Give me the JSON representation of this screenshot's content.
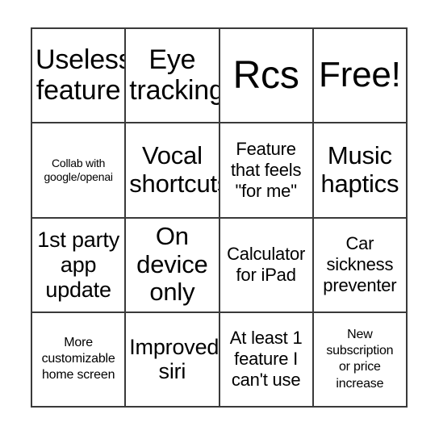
{
  "card": {
    "type": "bingo-card",
    "columns": 4,
    "rows": 4,
    "background_color": "#ffffff",
    "grid_line_color": "#3a3a3a",
    "text_color": "#000000",
    "cells": [
      {
        "text": "Useless\nfeature",
        "size": "fs-xxl"
      },
      {
        "text": "Eye\ntracking",
        "size": "fs-xxl"
      },
      {
        "text": "Rcs",
        "size": "fs-h0"
      },
      {
        "text": "Free!",
        "size": "fs-h1"
      },
      {
        "text": "Collab with\ngoogle/openai",
        "size": "fs-xs"
      },
      {
        "text": "Vocal\nshortcuts",
        "size": "fs-xl"
      },
      {
        "text": "Feature\nthat feels\n\"for me\"",
        "size": "fs-m"
      },
      {
        "text": "Music\nhaptics",
        "size": "fs-xl"
      },
      {
        "text": "1st party\napp\nupdate",
        "size": "fs-l"
      },
      {
        "text": "On\ndevice\nonly",
        "size": "fs-xl"
      },
      {
        "text": "Calculator\nfor iPad",
        "size": "fs-m"
      },
      {
        "text": "Car\nsickness\npreventer",
        "size": "fs-m"
      },
      {
        "text": "More\ncustomizable\nhome screen",
        "size": "fs-s"
      },
      {
        "text": "Improved\nsiri",
        "size": "fs-l"
      },
      {
        "text": "At least 1\nfeature I\ncan't use",
        "size": "fs-m"
      },
      {
        "text": "New\nsubscription\nor price\nincrease",
        "size": "fs-s"
      }
    ]
  }
}
